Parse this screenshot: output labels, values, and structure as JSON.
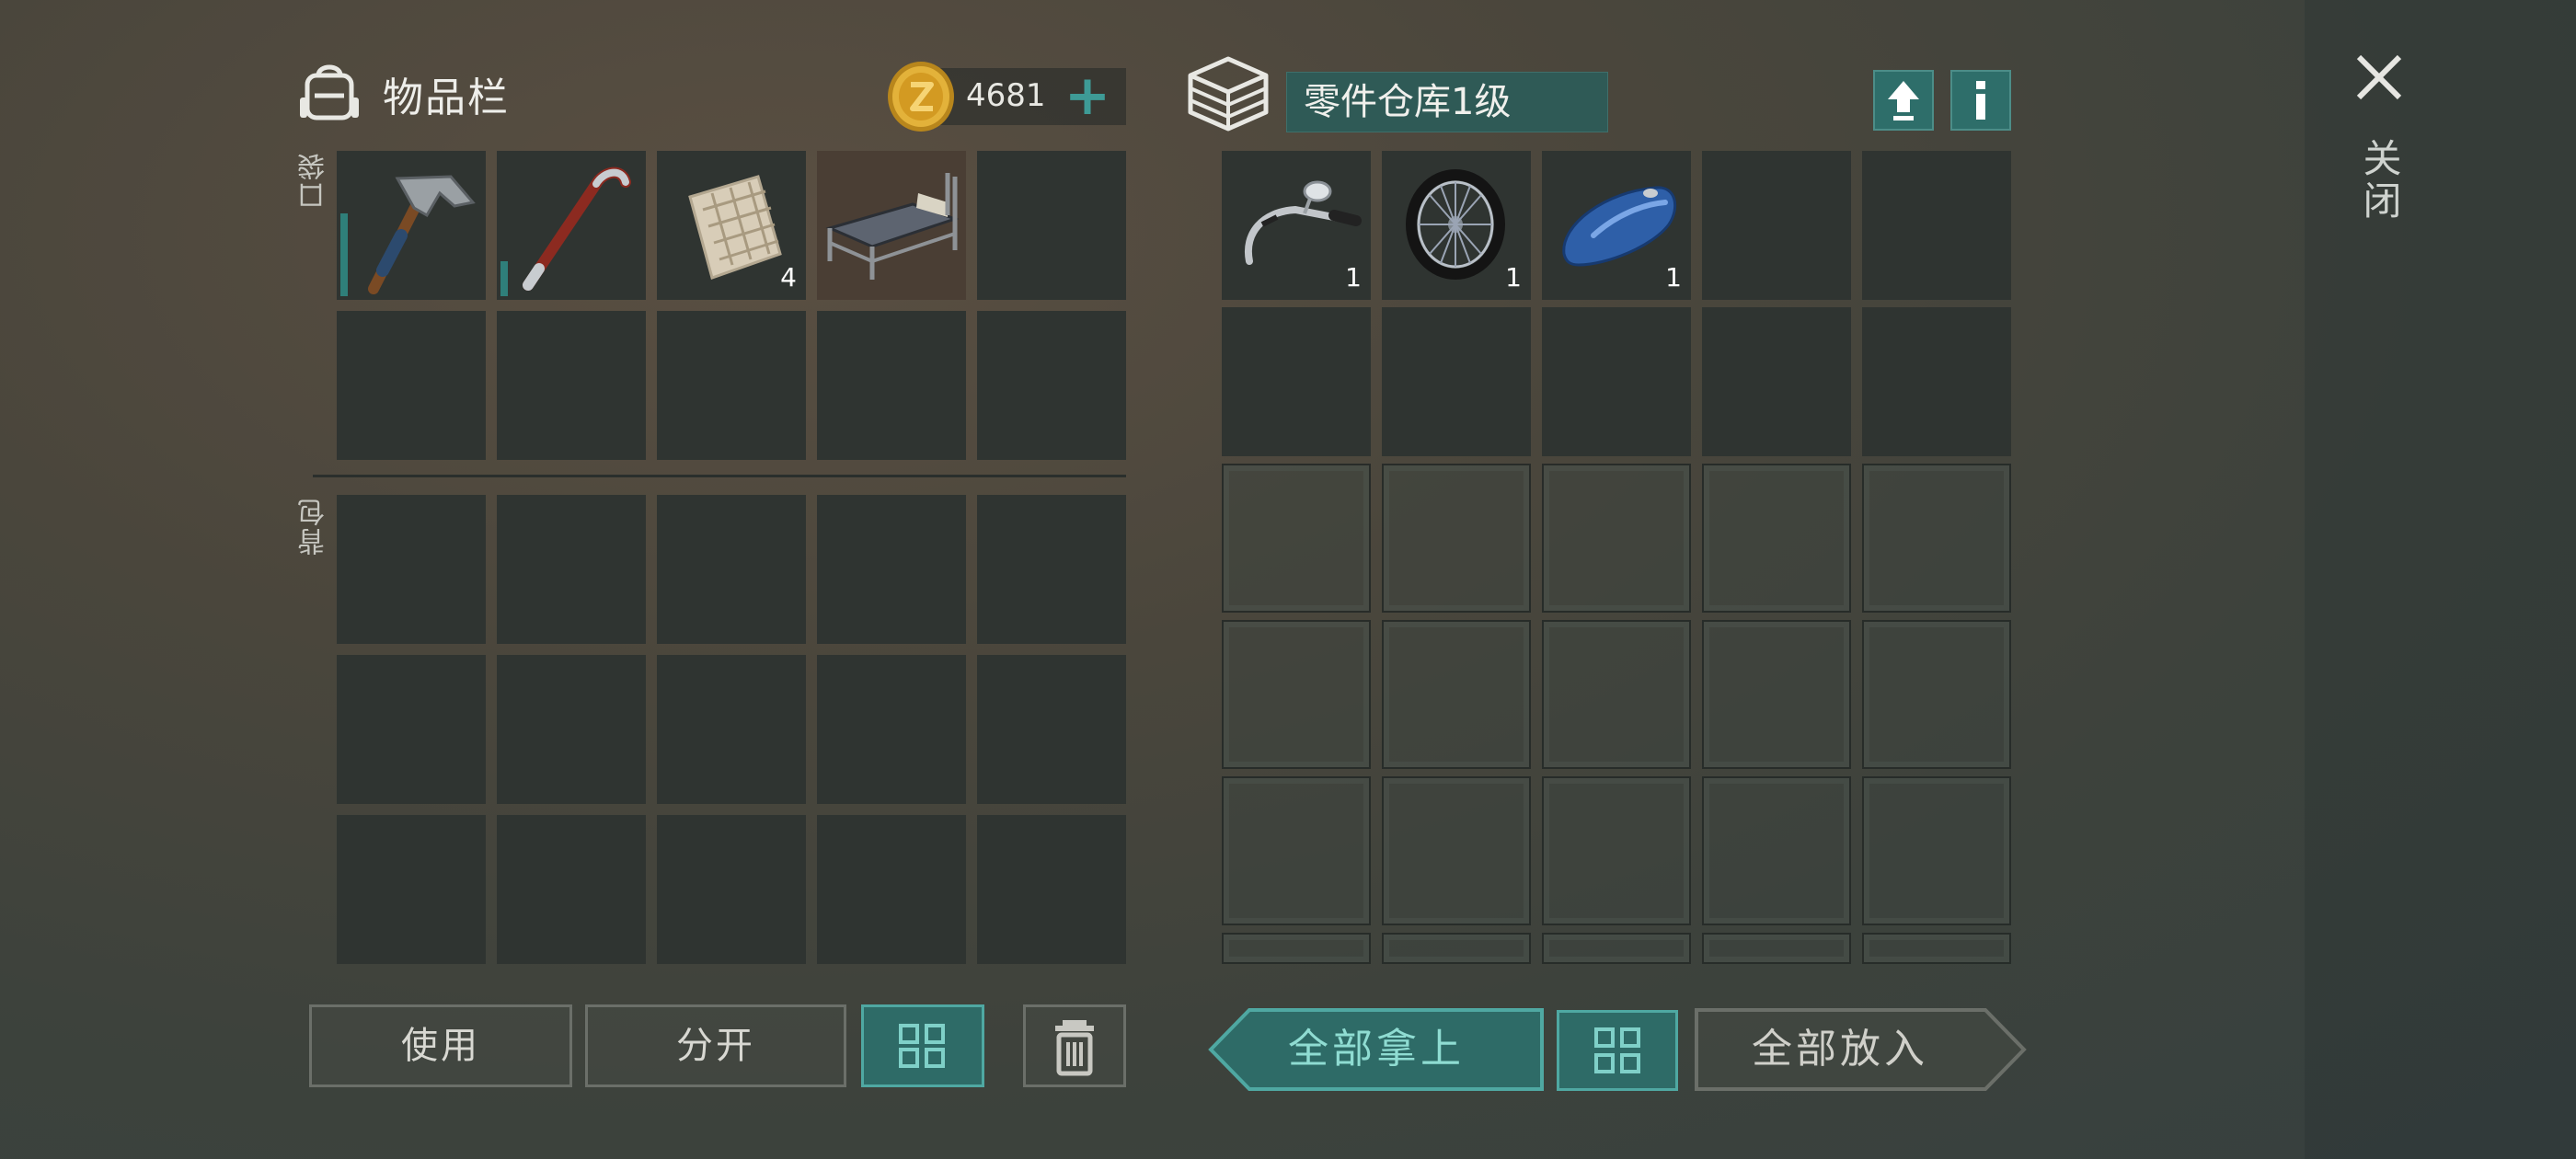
{
  "inventory": {
    "title": "物品栏",
    "coins": "4681",
    "add_coins_symbol": "+",
    "pocket_label": "口袋",
    "backpack_label": "背包",
    "pocket_items": [
      {
        "name": "hammer",
        "qty": "",
        "durability": 0.6
      },
      {
        "name": "crowbar",
        "qty": "",
        "durability": 0.25
      },
      {
        "name": "cloth",
        "qty": "4"
      },
      {
        "name": "bed",
        "qty": ""
      }
    ]
  },
  "storage": {
    "title": "零件仓库1级",
    "items": [
      {
        "name": "motorcycle-handlebar",
        "qty": "1"
      },
      {
        "name": "motorcycle-wheel",
        "qty": "1"
      },
      {
        "name": "fuel-tank",
        "qty": "1"
      }
    ]
  },
  "close_label": "关闭",
  "buttons": {
    "use": "使用",
    "split": "分开",
    "take_all": "全部拿上",
    "put_all": "全部放入"
  },
  "colors": {
    "accent_teal": "#2e6b67",
    "accent_teal_text": "#7fd0c8",
    "slot": "#2f3431"
  }
}
